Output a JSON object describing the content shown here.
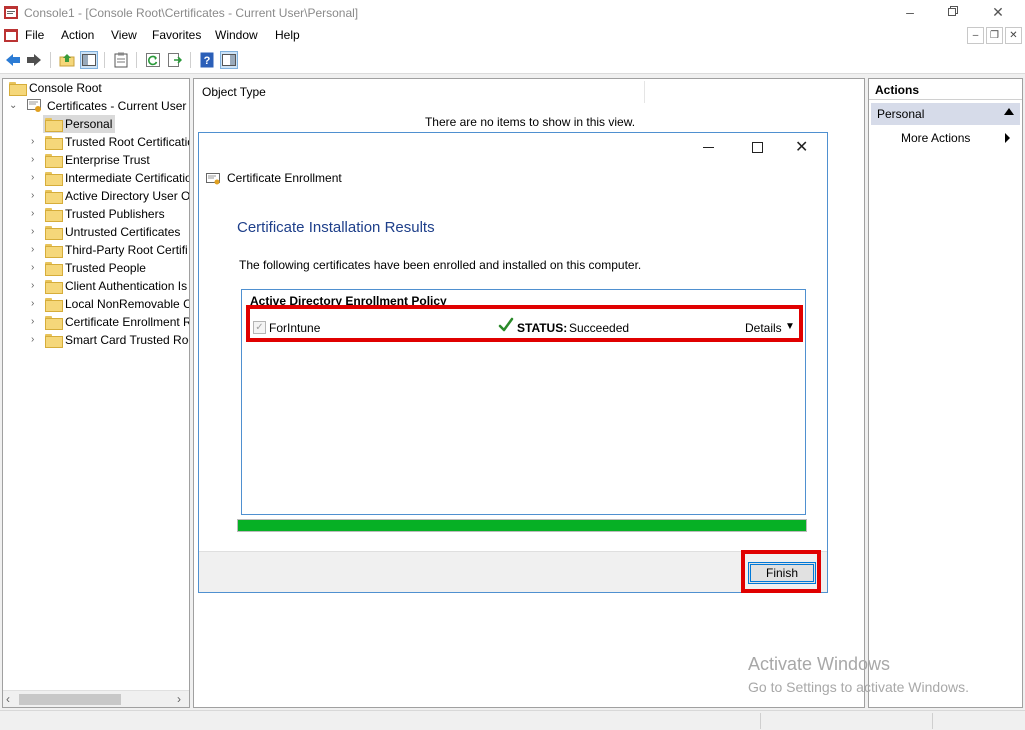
{
  "window": {
    "title": "Console1 - [Console Root\\Certificates - Current User\\Personal]"
  },
  "menu": [
    "File",
    "Action",
    "View",
    "Favorites",
    "Window",
    "Help"
  ],
  "tree": {
    "root": "Console Root",
    "store": "Certificates - Current User",
    "items": [
      "Personal",
      "Trusted Root Certificatio",
      "Enterprise Trust",
      "Intermediate Certificatio",
      "Active Directory User Ob",
      "Trusted Publishers",
      "Untrusted Certificates",
      "Third-Party Root Certifi",
      "Trusted People",
      "Client Authentication Is",
      "Local NonRemovable Ce",
      "Certificate Enrollment R",
      "Smart Card Trusted Roo"
    ]
  },
  "center": {
    "column_header": "Object Type",
    "empty_message": "There are no items to show in this view."
  },
  "actions": {
    "title": "Actions",
    "group": "Personal",
    "more": "More Actions"
  },
  "dialog": {
    "title": "Certificate Enrollment",
    "heading": "Certificate Installation Results",
    "description": "The following certificates have been enrolled and installed on this computer.",
    "policy": "Active Directory Enrollment Policy",
    "certificate": {
      "name": "ForIntune",
      "checked": true,
      "status_label": "STATUS:",
      "status_value": "Succeeded",
      "details_label": "Details"
    },
    "progress_fraction": 1.0,
    "finish_label": "Finish"
  },
  "watermark": {
    "line1": "Activate Windows",
    "line2": "Go to Settings to activate Windows."
  },
  "colors": {
    "progress": "#06b025",
    "highlight": "#e00000",
    "heading": "#1e3f8a",
    "dialog_border": "#4f90d0"
  }
}
